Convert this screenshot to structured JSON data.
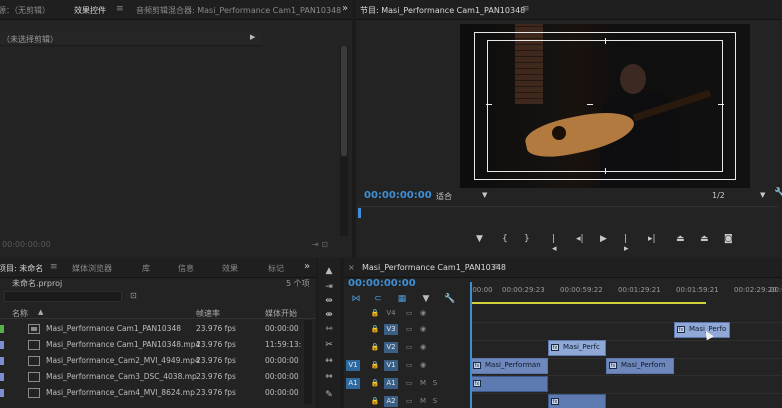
{
  "effects_panel": {
    "tab_source": "源：（无剪辑）",
    "tab_effects": "效果控件",
    "tab_mixer": "音频剪辑混合器: Masi_Performance Cam1_PAN10348",
    "clip_selector": "（未选择剪辑）",
    "footer_timecode": "00:00:00:00"
  },
  "program_monitor": {
    "title": "节目: Masi_Performance Cam1_PAN10348",
    "timecode": "00:00:00:00",
    "fit_label": "适合",
    "quality_label": "1/2"
  },
  "project_panel": {
    "tab_project": "项目: 未命名",
    "tab_media_browser": "媒体浏览器",
    "tab_library": "库",
    "tab_info": "信息",
    "tab_effects": "效果",
    "tab_markers": "标记",
    "project_file": "未命名.prproj",
    "item_count": "5 个项",
    "columns": {
      "name": "名称",
      "frame_rate": "帧速率",
      "media_start": "媒体开始"
    },
    "items": [
      {
        "name": "Masi_Performance Cam1_PAN10348",
        "fps": "23.976 fps",
        "start": "00:00:00",
        "swatch": "#59b04a",
        "icon": "sequence-icon"
      },
      {
        "name": "Masi_Performance Cam1_PAN10348.mp4",
        "fps": "23.976 fps",
        "start": "11:59:13:",
        "swatch": "#7a8fd0",
        "icon": "video-file-icon"
      },
      {
        "name": "Masi_Performance_Cam2_MVI_4949.mp4",
        "fps": "23.976 fps",
        "start": "00:00:00",
        "swatch": "#7a8fd0",
        "icon": "video-file-icon"
      },
      {
        "name": "Masi_Performance_Cam3_DSC_4038.mp",
        "fps": "23.976 fps",
        "start": "00:00:00",
        "swatch": "#7a8fd0",
        "icon": "video-file-icon"
      },
      {
        "name": "Masi_Performance_Cam4_MVI_8624.mp",
        "fps": "23.976 fps",
        "start": "00:00:00",
        "swatch": "#7a8fd0",
        "icon": "video-file-icon"
      }
    ]
  },
  "timeline": {
    "tab": "Masi_Performance Cam1_PAN10348",
    "timecode": "00:00:00:00",
    "ruler_ticks": [
      ":00:00",
      "00:00:29:23",
      "00:00:59:22",
      "00:01:29:21",
      "00:01:59:21",
      "00:02:29:20",
      "00:0"
    ],
    "tracks": {
      "v4": "V4",
      "v3": "V3",
      "v2": "V2",
      "v1": "V1",
      "a1": "A1",
      "a2": "A2",
      "src_v1": "V1",
      "src_a1": "A1",
      "mute": "M",
      "solo": "S"
    },
    "clips": {
      "v3_clip": "Masi_Perfo",
      "v2_clip": "Masi_Perfc",
      "v1_clip_a": "Masi_Performan",
      "v1_clip_b": "Masi_Perforn"
    }
  },
  "colors": {
    "accent": "#3f8fd6",
    "workarea": "#d4d23a",
    "clip": "#8fa8d6"
  }
}
